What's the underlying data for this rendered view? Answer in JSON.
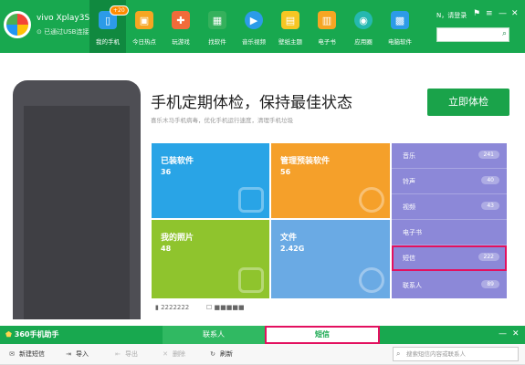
{
  "topbar": {
    "device_name": "vivo Xplay3S",
    "device_caret": "▾",
    "device_status": "已通过USB连接",
    "login_text": "N，请登录",
    "window_controls": [
      "⚑",
      "≡",
      "—",
      "✕"
    ],
    "search_icon": "⌕"
  },
  "nav": [
    {
      "label": "我的手机",
      "icon": "phone-icon",
      "glyph": "▯",
      "color": "#2c9be8",
      "badge": "+20"
    },
    {
      "label": "今日热点",
      "icon": "hot-icon",
      "glyph": "▣",
      "color": "#f6a623",
      "badge": ""
    },
    {
      "label": "玩游戏",
      "icon": "game-icon",
      "glyph": "✚",
      "color": "#f26b3a",
      "badge": ""
    },
    {
      "label": "找软件",
      "icon": "apps-icon",
      "glyph": "▦",
      "color": "#35b15c",
      "badge": ""
    },
    {
      "label": "音乐视频",
      "icon": "play-icon",
      "glyph": "▶",
      "color": "#2c9be8",
      "badge": ""
    },
    {
      "label": "壁纸主题",
      "icon": "wallpaper-icon",
      "glyph": "▤",
      "color": "#f6c623",
      "badge": ""
    },
    {
      "label": "电子书",
      "icon": "book-icon",
      "glyph": "▥",
      "color": "#f6a623",
      "badge": ""
    },
    {
      "label": "应用圈",
      "icon": "circle-icon",
      "glyph": "◉",
      "color": "#25b8b0",
      "badge": ""
    },
    {
      "label": "电脑软件",
      "icon": "pc-icon",
      "glyph": "▩",
      "color": "#2c9be8",
      "badge": ""
    }
  ],
  "main": {
    "headline": "手机定期体检，保持最佳状态",
    "subline": "喜乐木马手机病毒，优化手机运行速度，清理手机垃圾",
    "check_button": "立即体检"
  },
  "tiles": [
    {
      "label": "已装软件",
      "value": "36",
      "color": "#29a4e6"
    },
    {
      "label": "管理预装软件",
      "value": "56",
      "color": "#f5a02a"
    },
    {
      "label": "我的照片",
      "value": "48",
      "color": "#8fc42d"
    },
    {
      "label": "文件",
      "value": "2.42G",
      "color": "#6aaae4"
    }
  ],
  "side_list": [
    {
      "label": "音乐",
      "count": "241"
    },
    {
      "label": "铃声",
      "count": "40"
    },
    {
      "label": "视频",
      "count": "43"
    },
    {
      "label": "电子书",
      "count": ""
    },
    {
      "label": "短信",
      "count": "222",
      "highlight": true
    },
    {
      "label": "联系人",
      "count": "89"
    }
  ],
  "under_row": [
    "▮ 2222222",
    "☐ ■■■■■"
  ],
  "app": {
    "title": "360手机助手",
    "title_icon": "⬟",
    "tabs": {
      "contacts": "联系人",
      "sms": "短信"
    },
    "controls": [
      "—",
      "✕"
    ]
  },
  "toolbar": {
    "items": [
      {
        "label": "新建短信",
        "glyph": "✉",
        "disabled": false
      },
      {
        "label": "导入",
        "glyph": "⇥",
        "disabled": false
      },
      {
        "label": "导出",
        "glyph": "⇤",
        "disabled": true
      },
      {
        "label": "删除",
        "glyph": "✕",
        "disabled": true
      },
      {
        "label": "刷新",
        "glyph": "↻",
        "disabled": false
      }
    ],
    "search_placeholder": "搜索短信内容或联系人",
    "search_icon": "⌕"
  }
}
